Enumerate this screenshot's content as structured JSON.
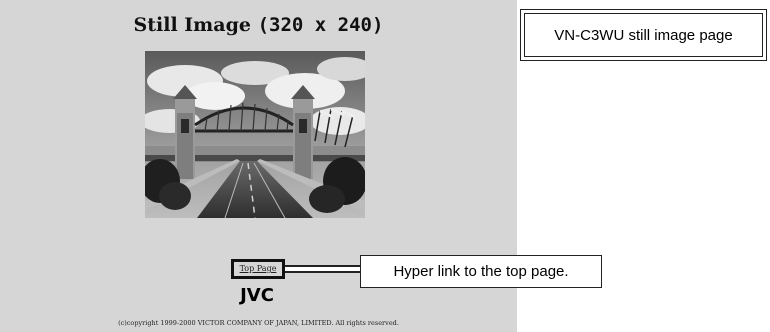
{
  "page": {
    "title_text": "Still Image",
    "title_size": "(320 x 240)",
    "top_link_label": "Top Page",
    "logo_text": "JVC",
    "copyright": "(c)copyright 1999-2000 VICTOR COMPANY OF JAPAN, LIMITED. All rights reserved."
  },
  "annotations": {
    "page_label": "VN-C3WU still image page",
    "link_label": "Hyper link to the top page."
  },
  "image": {
    "content": "bridge-photo",
    "grayscale": true
  },
  "colors": {
    "panel_background": "#d6d6d6",
    "callout_background": "#ffffff",
    "border": "#222222"
  }
}
